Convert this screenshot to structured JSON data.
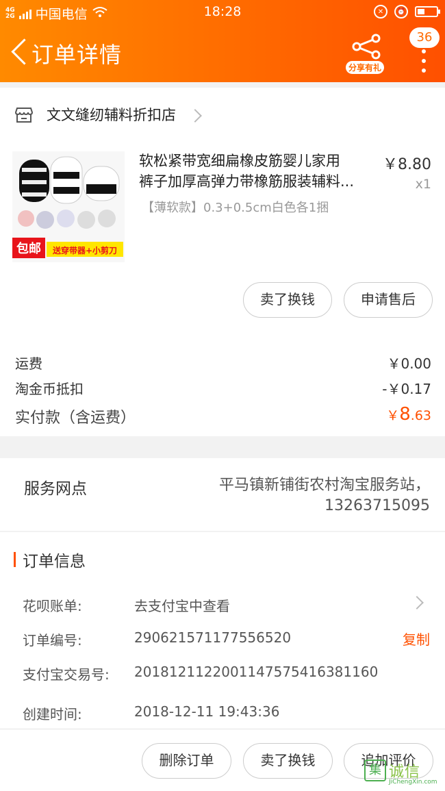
{
  "status_bar": {
    "network": "4G",
    "network2": "2G",
    "carrier": "中国电信",
    "time": "18:28"
  },
  "nav": {
    "title": "订单详情",
    "share_label": "分享有礼",
    "badge_count": "36"
  },
  "shop": {
    "name": "文文缝纫辅料折扣店"
  },
  "product": {
    "title_line1": "软松紧带宽细扁橡皮筋婴儿家用",
    "title_line2": "裤子加厚高弹力带橡筋服装辅料...",
    "price": "￥8.80",
    "qty": "x1",
    "sku": "【薄软款】0.3+0.5cm白色各1捆",
    "image_badge_left": "包邮",
    "image_badge_right": "送穿带器+小剪刀"
  },
  "item_actions": {
    "sell": "卖了换钱",
    "after_sale": "申请售后"
  },
  "fees": {
    "shipping_label": "运费",
    "shipping_value": "￥0.00",
    "coin_label": "淘金币抵扣",
    "coin_value": "-￥0.17",
    "paid_label": "实付款（含运费）",
    "paid_currency": "￥",
    "paid_int": "8",
    "paid_dec": ".63"
  },
  "service": {
    "label": "服务网点",
    "value_line1": "平马镇新铺街农村淘宝服务站，",
    "value_line2": "13263715095"
  },
  "order_info": {
    "title": "订单信息",
    "huabei_label": "花呗账单:",
    "huabei_value": "去支付宝中查看",
    "order_no_label": "订单编号:",
    "order_no_value": "290621571177556520",
    "copy": "复制",
    "alipay_label": "支付宝交易号:",
    "alipay_value": "2018121122001147575416381160",
    "created_label": "创建时间:",
    "created_value": "2018-12-11 19:43:36"
  },
  "bottom_actions": {
    "delete": "删除订单",
    "sell": "卖了换钱",
    "review": "追加评价"
  },
  "watermark": {
    "logo_char": "集",
    "text": "诚信",
    "sub": "JiChengXin.com"
  },
  "colors": {
    "accent": "#ff5000",
    "header_start": "#ff8a00"
  }
}
